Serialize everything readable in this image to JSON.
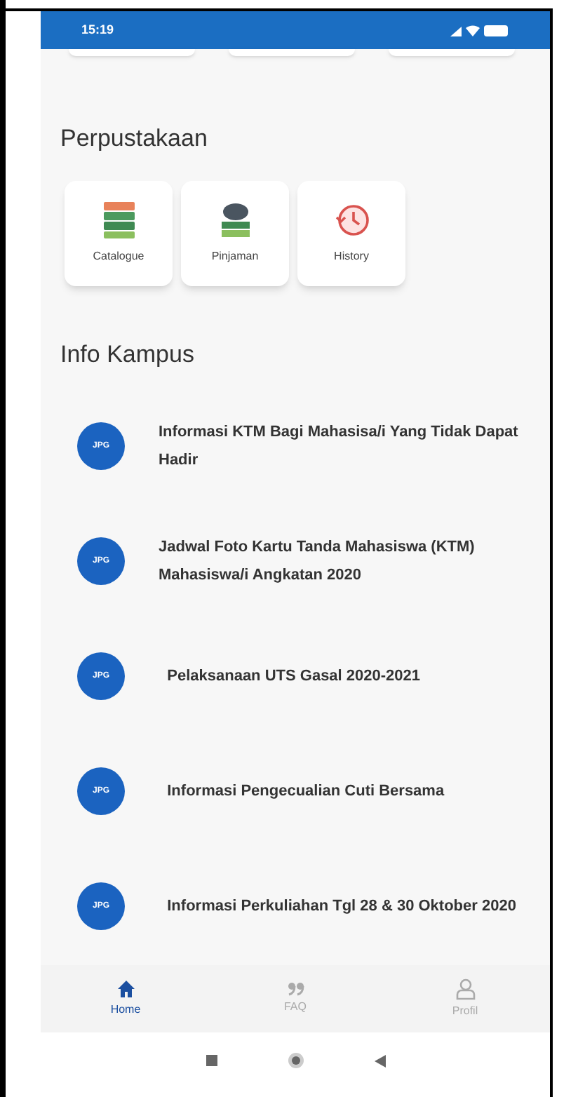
{
  "status_bar": {
    "time": "15:19"
  },
  "library": {
    "title": "Perpustakaan",
    "items": [
      {
        "label": "Catalogue",
        "kind": "books"
      },
      {
        "label": "Pinjaman",
        "kind": "borrow"
      },
      {
        "label": "History",
        "kind": "history"
      }
    ]
  },
  "info": {
    "title": "Info Kampus",
    "items": [
      {
        "badge": "JPG",
        "title": "Informasi KTM Bagi Mahasisa/i Yang Tidak Dapat Hadir"
      },
      {
        "badge": "JPG",
        "title": "Jadwal Foto Kartu Tanda Mahasiswa (KTM) Mahasiswa/i Angkatan 2020"
      },
      {
        "badge": "JPG",
        "title": "  Pelaksanaan UTS Gasal 2020-2021"
      },
      {
        "badge": "JPG",
        "title": "  Informasi Pengecualian Cuti Bersama"
      },
      {
        "badge": "JPG",
        "title": "  Informasi Perkuliahan Tgl 28 & 30 Oktober 2020"
      }
    ]
  },
  "bottom_nav": [
    {
      "label": "Home",
      "kind": "home",
      "selected": true
    },
    {
      "label": "FAQ",
      "kind": "faq",
      "selected": false
    },
    {
      "label": "Profil",
      "kind": "profile",
      "selected": false
    }
  ]
}
